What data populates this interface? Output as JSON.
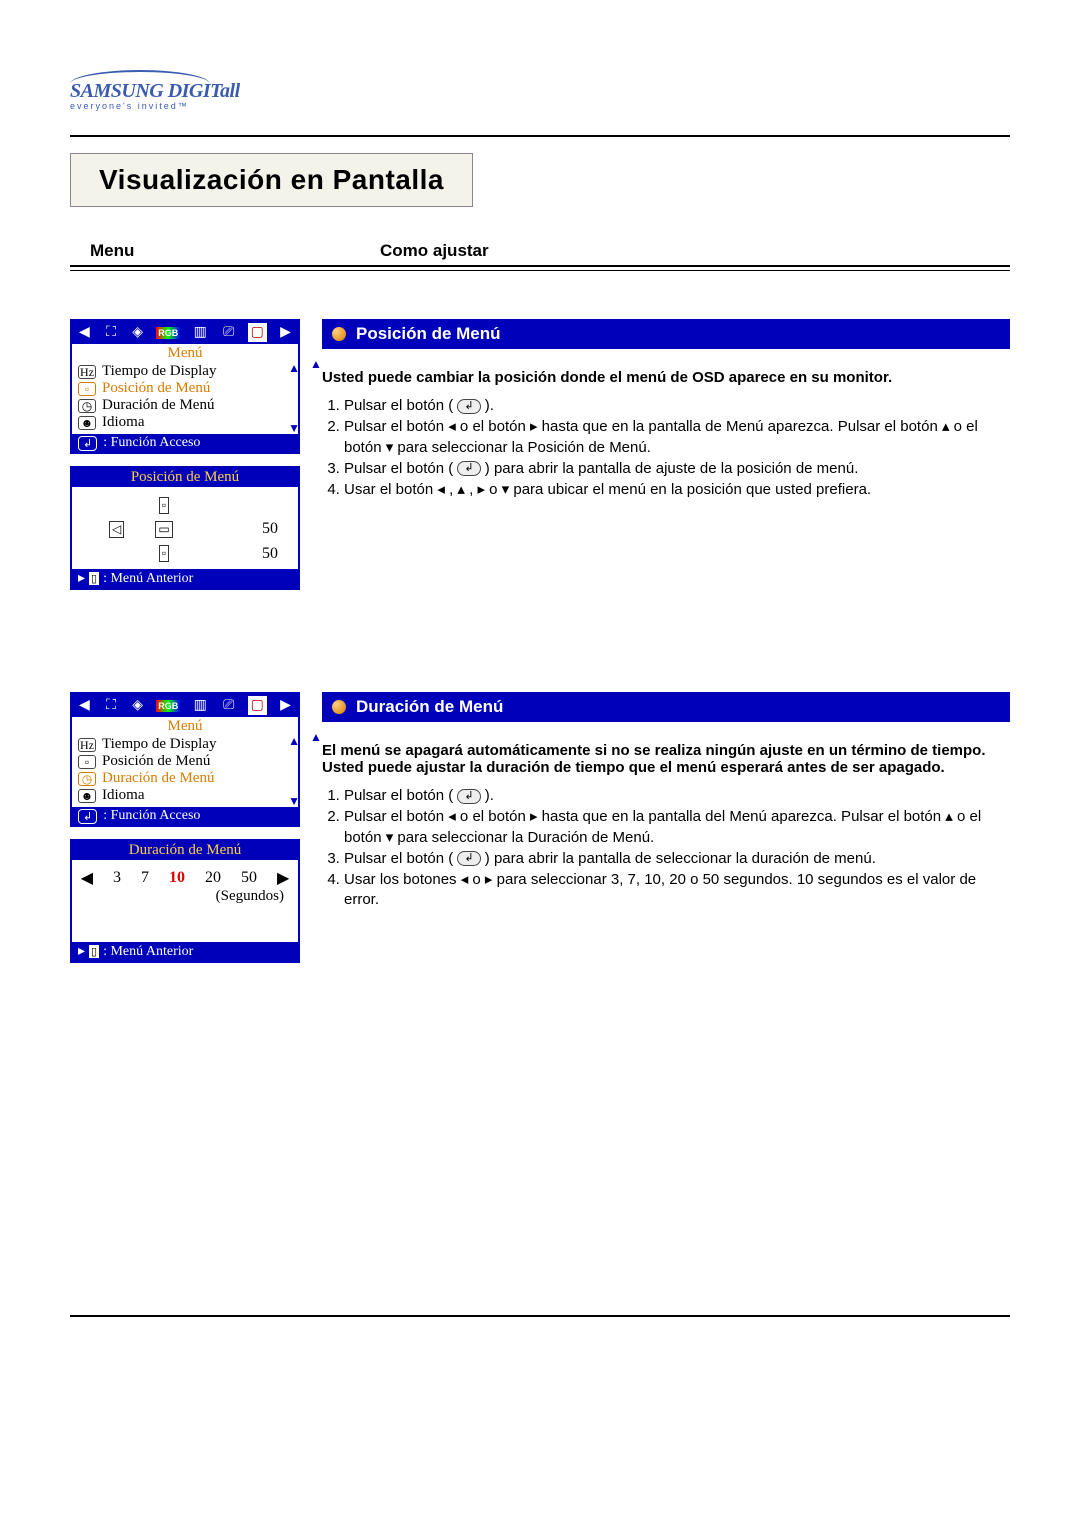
{
  "logo": {
    "brand": "SAMSUNG DIGITall",
    "tagline": "everyone's invited™"
  },
  "page_title": "Visualización en Pantalla",
  "column_headers": {
    "menu": "Menu",
    "howto": "Como ajustar"
  },
  "osd_common": {
    "menu_title": "Menú",
    "func_label": ": Función Acceso",
    "prev_label": ": Menú Anterior",
    "items": {
      "display_time": "Tiempo de Display",
      "menu_pos": "Posición de Menú",
      "menu_dur": "Duración de Menú",
      "language": "Idioma"
    }
  },
  "section_pos": {
    "bar_title": "Posición de Menú",
    "osd_control_title": "Posición de Menú",
    "values": {
      "h": "50",
      "v": "50"
    },
    "intro": "Usted puede cambiar la posición donde el menú de OSD aparece en su monitor.",
    "steps": {
      "1": "Pulsar el botón (",
      "1b": ").",
      "2": "Pulsar el botón ◂ o el botón ▸ hasta que en la pantalla de Menú aparezca. Pulsar el botón ▴ o el botón ▾ para seleccionar la Posición de Menú.",
      "3a": "Pulsar el botón (",
      "3b": ") para abrir la pantalla de ajuste de la posición de menú.",
      "4": "Usar el botón ◂ , ▴ , ▸ o ▾ para ubicar el menú en la posición que usted prefiera."
    }
  },
  "section_dur": {
    "bar_title": "Duración de Menú",
    "osd_control_title": "Duración de Menú",
    "options": {
      "a": "3",
      "b": "7",
      "c": "10",
      "d": "20",
      "e": "50"
    },
    "unit": "(Segundos)",
    "intro": "El menú se apagará automáticamente si no se realiza ningún ajuste en un término de tiempo. Usted puede ajustar la duración de tiempo que el menú esperará antes de ser apagado.",
    "steps": {
      "1": "Pulsar el botón (",
      "1b": ").",
      "2": "Pulsar el botón ◂ o el botón ▸ hasta que en la pantalla del Menú aparezca. Pulsar el botón ▴ o el botón ▾ para seleccionar la Duración de Menú.",
      "3a": "Pulsar el botón (",
      "3b": ") para abrir la pantalla de seleccionar la duración de menú.",
      "4": "Usar los botones ◂ o ▸ para seleccionar 3, 7, 10, 20 o 50 segundos. 10 segundos es el valor de error."
    }
  }
}
